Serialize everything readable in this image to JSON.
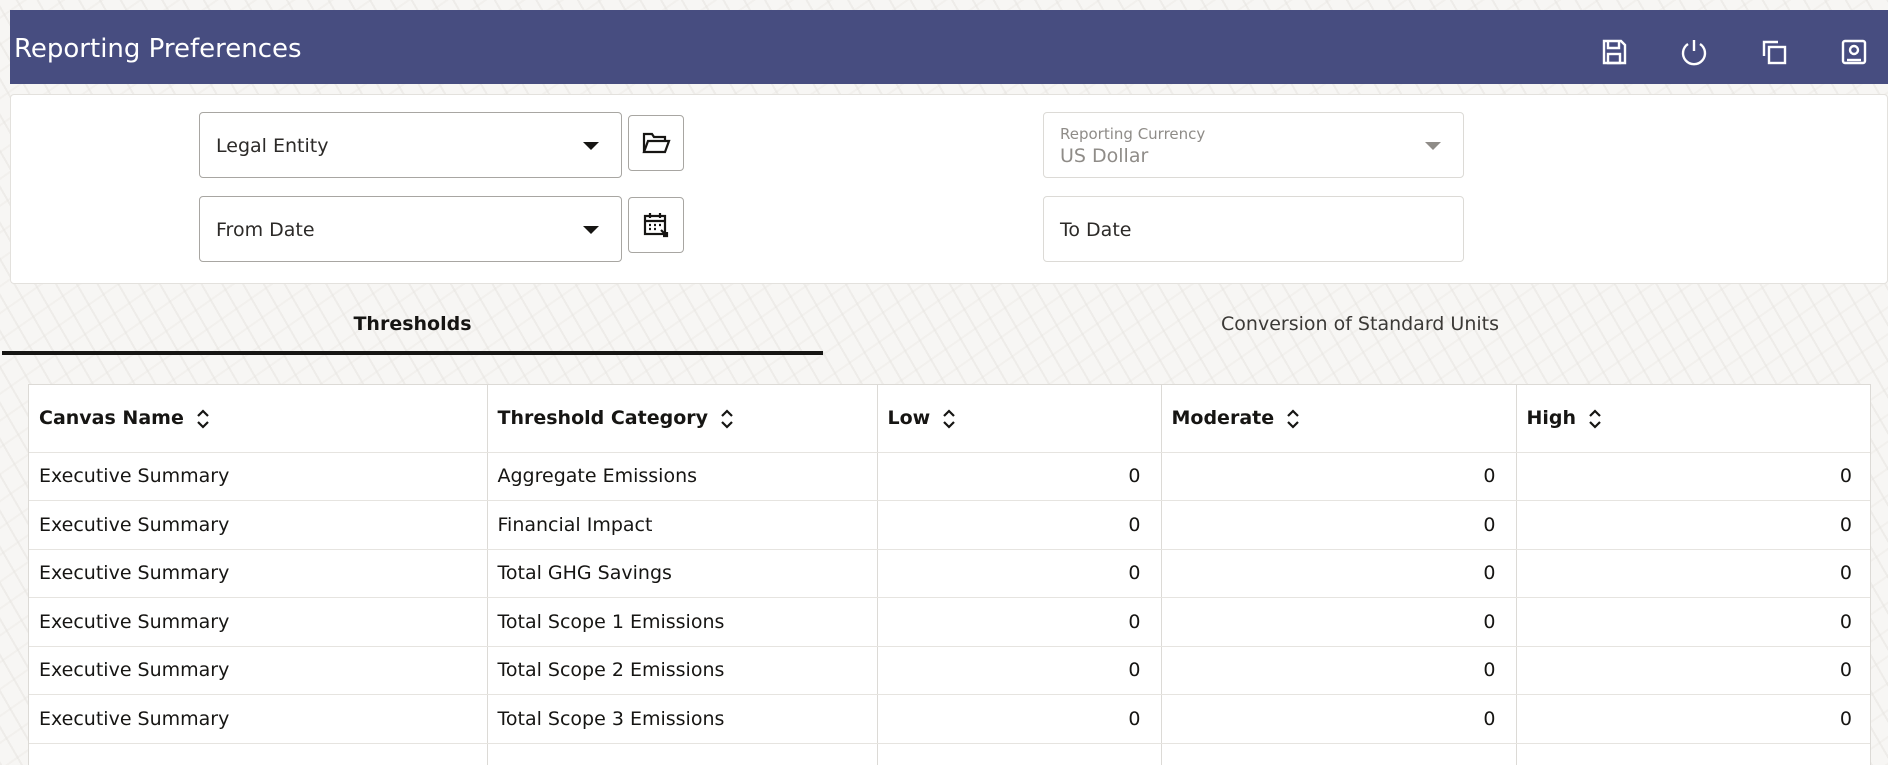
{
  "header": {
    "title": "Reporting Preferences",
    "icons": [
      "save-icon",
      "power-icon",
      "copy-icon",
      "profile-icon"
    ]
  },
  "filters": {
    "legal_entity": {
      "label": "Legal Entity"
    },
    "from_date": {
      "label": "From Date"
    },
    "reporting_currency": {
      "label": "Reporting Currency",
      "value": "US Dollar"
    },
    "to_date": {
      "label": "To Date"
    }
  },
  "tabs": [
    {
      "label": "Thresholds",
      "active": true
    },
    {
      "label": "Conversion of Standard Units",
      "active": false
    }
  ],
  "table": {
    "columns": [
      "Canvas Name",
      "Threshold Category",
      "Low",
      "Moderate",
      "High"
    ],
    "rows": [
      {
        "canvas": "Executive Summary",
        "category": "Aggregate Emissions",
        "low": "0",
        "moderate": "0",
        "high": "0"
      },
      {
        "canvas": "Executive Summary",
        "category": "Financial Impact",
        "low": "0",
        "moderate": "0",
        "high": "0"
      },
      {
        "canvas": "Executive Summary",
        "category": "Total GHG Savings",
        "low": "0",
        "moderate": "0",
        "high": "0"
      },
      {
        "canvas": "Executive Summary",
        "category": "Total Scope 1 Emissions",
        "low": "0",
        "moderate": "0",
        "high": "0"
      },
      {
        "canvas": "Executive Summary",
        "category": "Total Scope 2 Emissions",
        "low": "0",
        "moderate": "0",
        "high": "0"
      },
      {
        "canvas": "Executive Summary",
        "category": "Total Scope 3 Emissions",
        "low": "0",
        "moderate": "0",
        "high": "0"
      },
      {
        "canvas": "",
        "category": "",
        "low": "",
        "moderate": "",
        "high": ""
      }
    ]
  },
  "colors": {
    "header_bg": "#474d80",
    "text": "#161513",
    "muted_text": "#8f8c88"
  }
}
